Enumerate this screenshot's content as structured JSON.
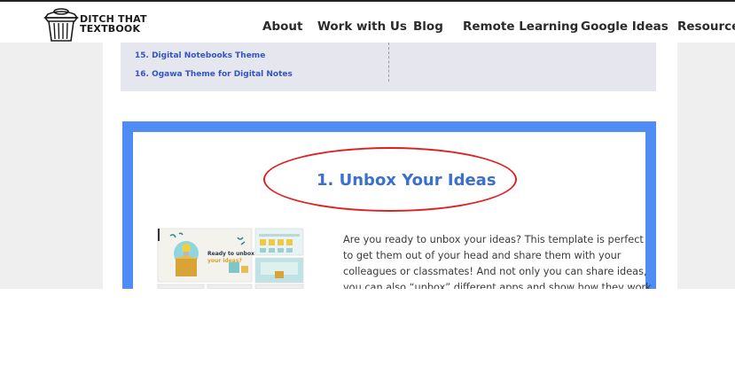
{
  "header": {
    "logo_line1": "DITCH THAT",
    "logo_line2": "TEXTBOOK",
    "nav": [
      "About",
      "Work with Us",
      "Blog",
      "Remote Learning",
      "Google Ideas",
      "Resource"
    ]
  },
  "toc": {
    "items": [
      "15. Digital Notebooks Theme",
      "16. Ogawa Theme for Digital Notes"
    ]
  },
  "section": {
    "title": "1. Unbox Your Ideas",
    "thumbnail": {
      "headline_line1": "Ready to unbox",
      "headline_line2": "your ideas?"
    },
    "description_lines": [
      "Are you ready to unbox your ideas? This template is perfect",
      "to get them out of your head and share them with your",
      "colleagues or classmates! And not only you can share ideas,",
      "you can also “unbox” different apps and show how they work."
    ]
  },
  "colors": {
    "accent_blue": "#4f8df5",
    "link_blue": "#3355c4",
    "title_blue": "#3b6fd0",
    "annotation_red": "#e02020"
  }
}
